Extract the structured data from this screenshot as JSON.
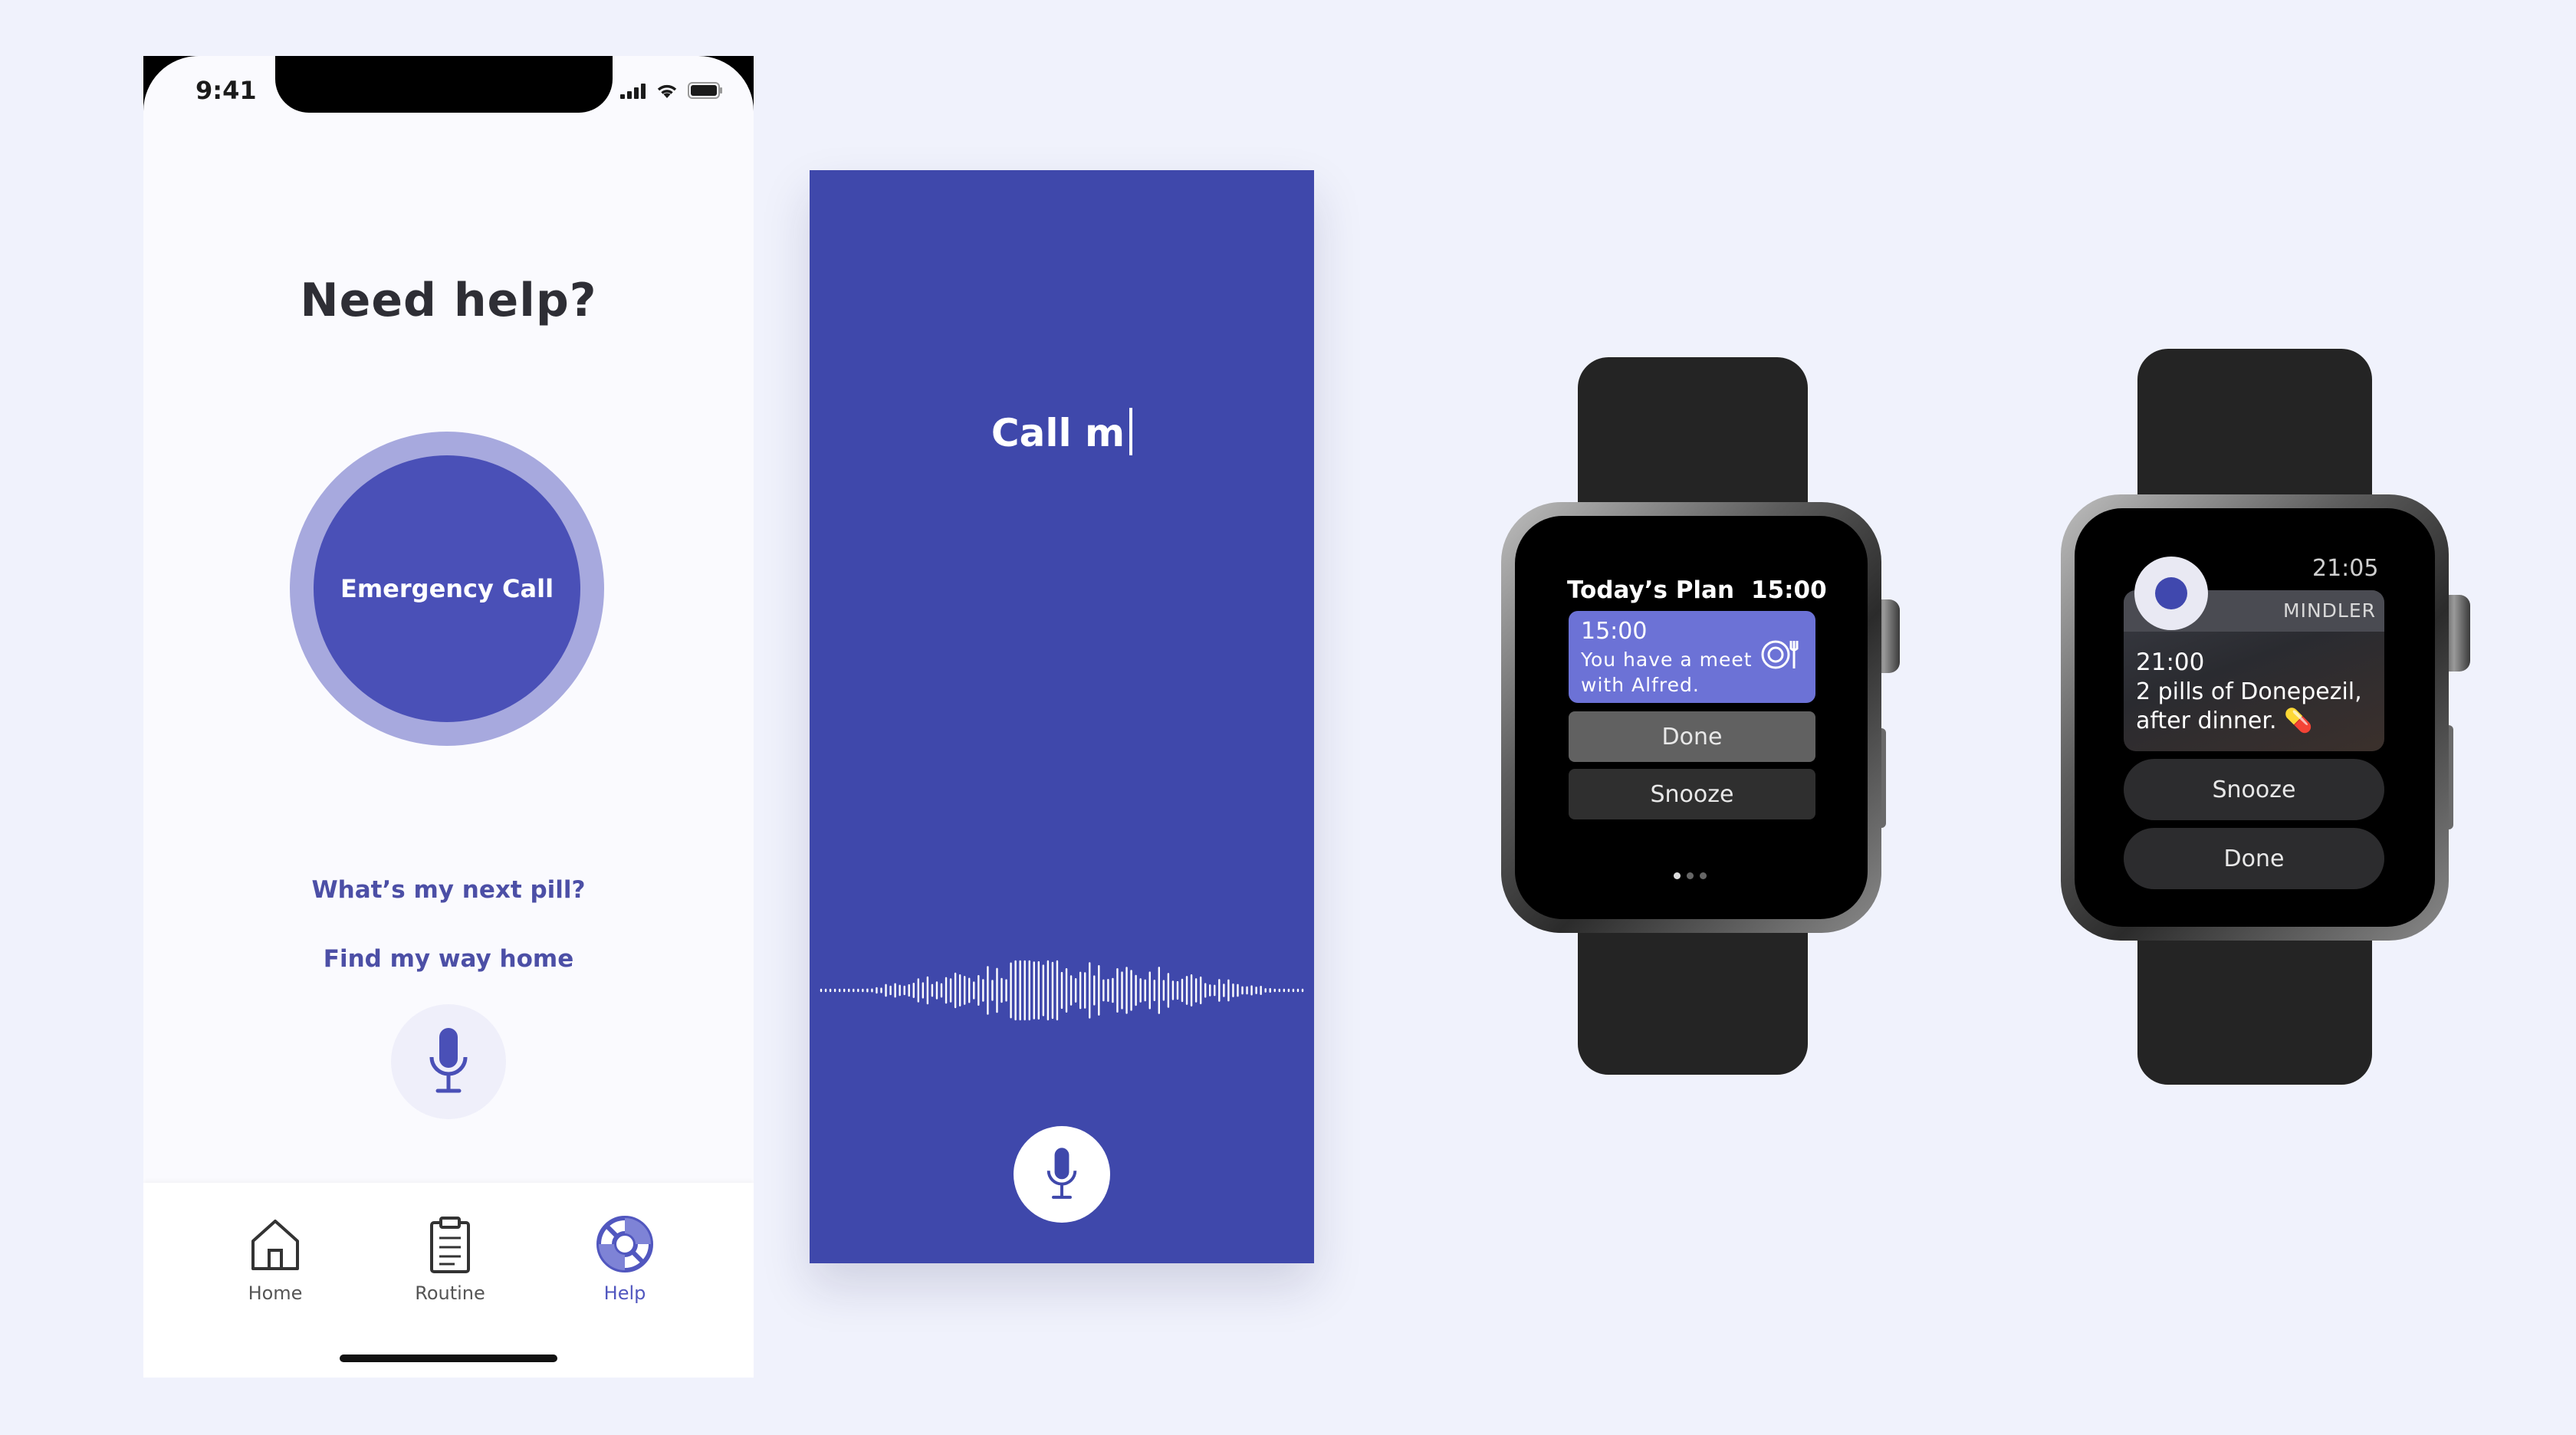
{
  "phone_help": {
    "status_time": "9:41",
    "title": "Need help?",
    "emergency_button": "Emergency Call",
    "quick_links": [
      "What’s my next pill?",
      "Find my way home"
    ],
    "tabs": [
      {
        "label": "Home",
        "icon": "home-icon",
        "active": false
      },
      {
        "label": "Routine",
        "icon": "clipboard-icon",
        "active": false
      },
      {
        "label": "Help",
        "icon": "lifebuoy-icon",
        "active": true
      }
    ]
  },
  "phone_voice": {
    "transcript": "Call m"
  },
  "watch_plan": {
    "title": "Today’s Plan",
    "time": "15:00",
    "card": {
      "time": "15:00",
      "message": "You have a meet with Alfred.",
      "icon": "dining-icon"
    },
    "done_label": "Done",
    "snooze_label": "Snooze"
  },
  "watch_reminder": {
    "time": "21:05",
    "app_name": "MINDLER",
    "reminder_time": "21:00",
    "reminder_text": "2 pills of Donepezil, after dinner.",
    "reminder_emoji": "💊",
    "snooze_label": "Snooze",
    "done_label": "Done"
  },
  "colors": {
    "background": "#F0F2FC",
    "primary": "#4A50B7",
    "voice_bg": "#3F48AB",
    "ring": "#A7A9DE",
    "card": "#6C72D6"
  }
}
